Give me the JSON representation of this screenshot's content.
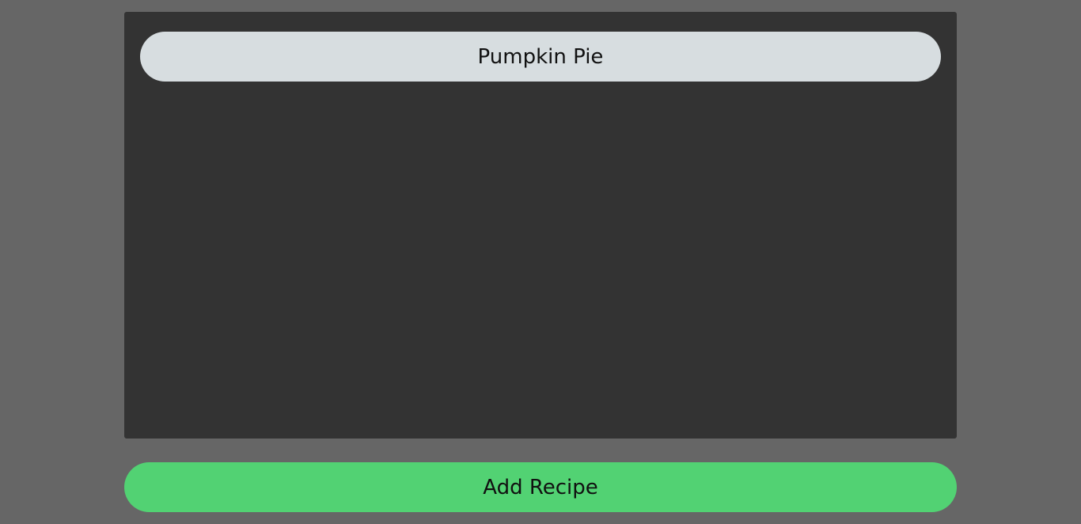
{
  "recipes": {
    "items": [
      {
        "name": "Pumpkin Pie"
      }
    ]
  },
  "actions": {
    "add_recipe_label": "Add Recipe"
  },
  "colors": {
    "background": "#666666",
    "panel": "#333333",
    "recipe_item": "#d7dde0",
    "add_button": "#52d273",
    "text": "#111111"
  }
}
